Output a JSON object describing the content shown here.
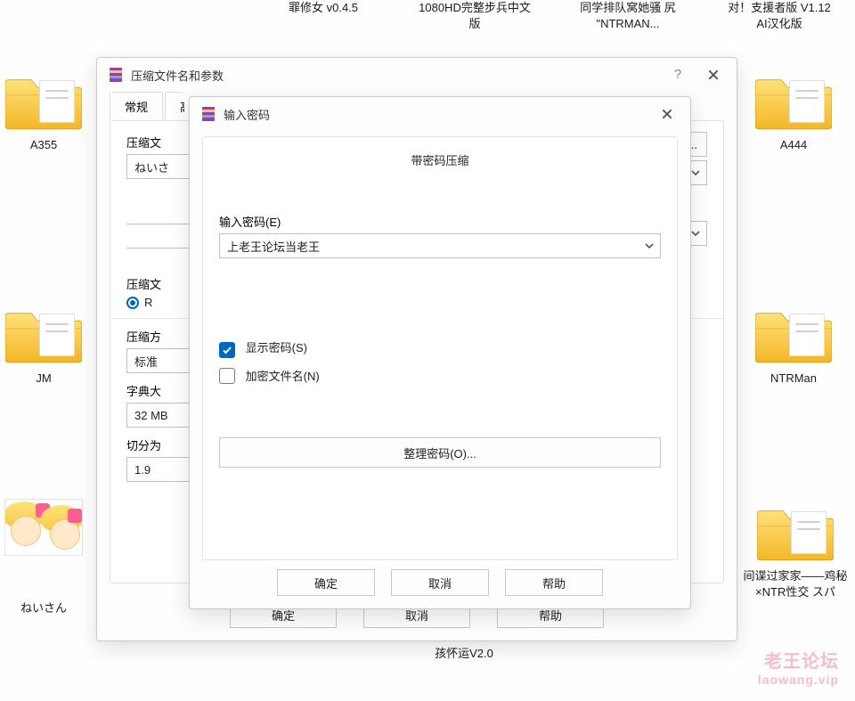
{
  "desktop_top_labels": {
    "a": "罪修女 v0.4.5",
    "b": "1080HD完整步兵中文版",
    "c": "同学排队窝她骚 尻 \"NTRMAN...",
    "d": "对！支援者版 V1.12 AI汉化版"
  },
  "desktop_items": {
    "left1_label": "A355",
    "left2_label": "JM",
    "left3_label": "ねいさん",
    "right1_label": "A444",
    "right2_label": "NTRMan",
    "right3_label": "间谍过家家——鸡秘×NTR性交 スパ",
    "bottom_center_label": "孩怀运V2.0"
  },
  "outer_dialog": {
    "title": "压缩文件名和参数",
    "tabs": {
      "general": "常规",
      "partial": "高"
    },
    "labels": {
      "archive_name_prefix": "压缩文",
      "archive_format_prefix": "压缩文",
      "compress_method_prefix": "压缩方",
      "dict_size_prefix": "字典大",
      "split_size_prefix": "切分为"
    },
    "values": {
      "filename_partial": "ねいさ",
      "radio_rar": "R",
      "method": "标准",
      "dict_size": "32 MB",
      "split_size": "1.9"
    },
    "right_browse": "(B)...",
    "buttons": {
      "ok": "确定",
      "cancel": "取消",
      "help": "帮助"
    }
  },
  "inner_dialog": {
    "title": "输入密码",
    "heading": "带密码压缩",
    "enter_password_label": "输入密码(E)",
    "password_value": "上老王论坛当老王",
    "show_password_label": "显示密码(S)",
    "encrypt_names_label": "加密文件名(N)",
    "manage_passwords_btn": "整理密码(O)...",
    "buttons": {
      "ok": "确定",
      "cancel": "取消",
      "help": "帮助"
    }
  },
  "watermark": {
    "line1": "老王论坛",
    "line2": "laowang.vip"
  },
  "icons": {
    "app": "winrar-icon",
    "close": "close-icon",
    "help": "help-icon",
    "chevron_down": "chevron-down-icon",
    "tick": "check-icon",
    "folder": "folder-icon"
  }
}
